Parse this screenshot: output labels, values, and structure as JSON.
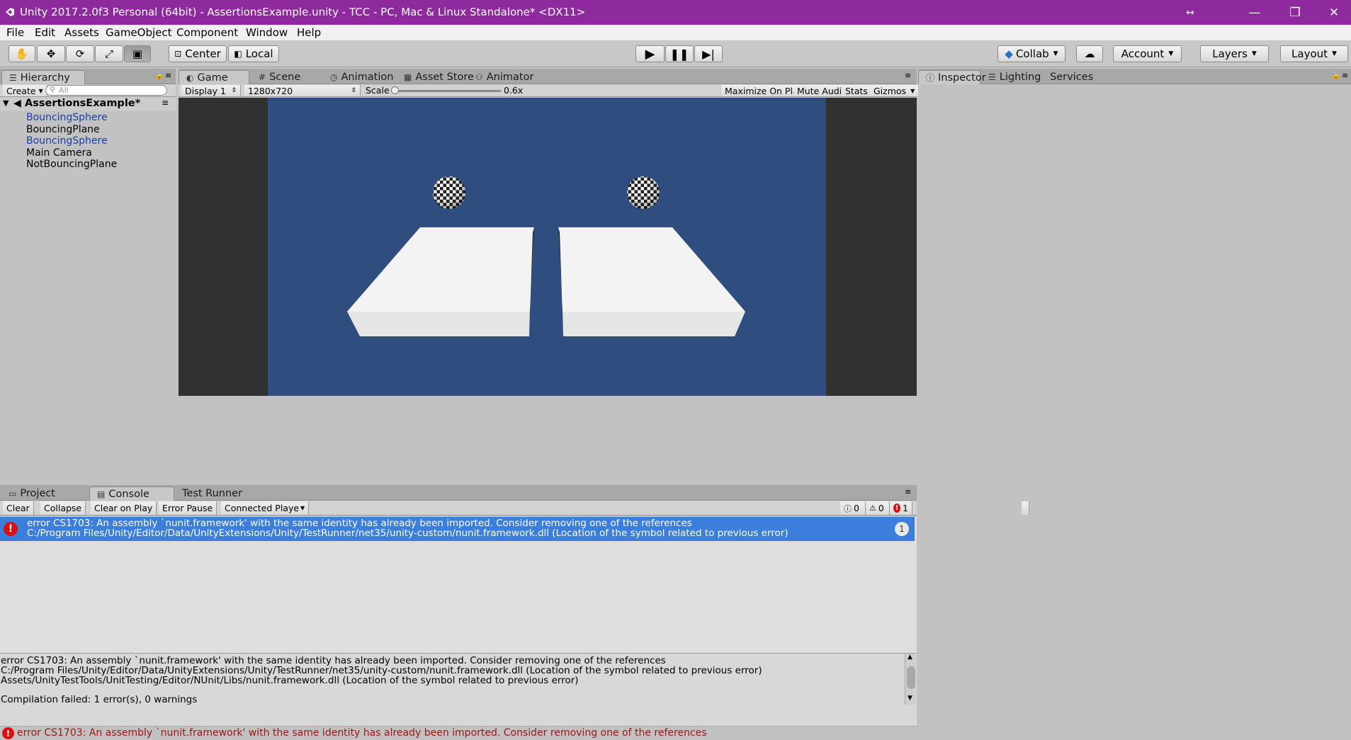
{
  "window": {
    "title": "Unity 2017.2.0f3 Personal (64bit) - AssertionsExample.unity - TCC - PC, Mac & Linux Standalone* <DX11>"
  },
  "menu": [
    "File",
    "Edit",
    "Assets",
    "GameObject",
    "Component",
    "Window",
    "Help"
  ],
  "toolbar": {
    "pivot_label": "Center",
    "space_label": "Local",
    "collab_label": "Collab",
    "account_label": "Account",
    "layers_label": "Layers",
    "layout_label": "Layout"
  },
  "hierarchy": {
    "tab_label": "Hierarchy",
    "create_label": "Create",
    "search_placeholder": "All",
    "scene_name": "AssertionsExample*",
    "items": [
      {
        "label": "BouncingSphere",
        "prefab": true
      },
      {
        "label": "BouncingPlane",
        "prefab": false
      },
      {
        "label": "BouncingSphere",
        "prefab": true
      },
      {
        "label": "Main Camera",
        "prefab": false
      },
      {
        "label": "NotBouncingPlane",
        "prefab": false
      }
    ]
  },
  "center_tabs": [
    "Game",
    "Scene",
    "Animation",
    "Asset Store",
    "Animator"
  ],
  "game": {
    "display": "Display 1",
    "resolution": "1280x720",
    "scale_label": "Scale",
    "scale_value": "0.6x",
    "scale_fraction": 0.0,
    "maximize_label": "Maximize On Play",
    "mute_label": "Mute Audio",
    "stats_label": "Stats",
    "gizmos_label": "Gizmos",
    "sky_color": "#2f4d7e"
  },
  "inspector_tabs": [
    "Inspector",
    "Lighting",
    "Services"
  ],
  "bottom_tabs": [
    "Project",
    "Console",
    "Test Runner"
  ],
  "console": {
    "clear_label": "Clear",
    "collapse_label": "Collapse",
    "clear_on_play_label": "Clear on Play",
    "error_pause_label": "Error Pause",
    "connected_player_label": "Connected Playe",
    "info_count": "0",
    "warning_count": "0",
    "error_count": "1",
    "entry": {
      "line1": "error CS1703: An assembly `nunit.framework' with the same identity has already been imported. Consider removing one of the references",
      "line2": "C:/Program Files/Unity/Editor/Data/UnityExtensions/Unity/TestRunner/net35/unity-custom/nunit.framework.dll (Location of the symbol related to previous error)",
      "count": "1"
    },
    "detail": [
      "error CS1703: An assembly `nunit.framework' with the same identity has already been imported. Consider removing one of the references",
      "C:/Program Files/Unity/Editor/Data/UnityExtensions/Unity/TestRunner/net35/unity-custom/nunit.framework.dll (Location of the symbol related to previous error)",
      "Assets/UnityTestTools/UnitTesting/Editor/NUnit/Libs/nunit.framework.dll (Location of the symbol related to previous error)",
      "",
      "Compilation failed: 1 error(s), 0 warnings"
    ]
  },
  "status": {
    "text": "error CS1703: An assembly `nunit.framework' with the same identity has already been imported. Consider removing one of the references"
  },
  "colors": {
    "title_bar": "#8e2a9e",
    "selection": "#3c7edc",
    "error_red": "#d81010"
  }
}
